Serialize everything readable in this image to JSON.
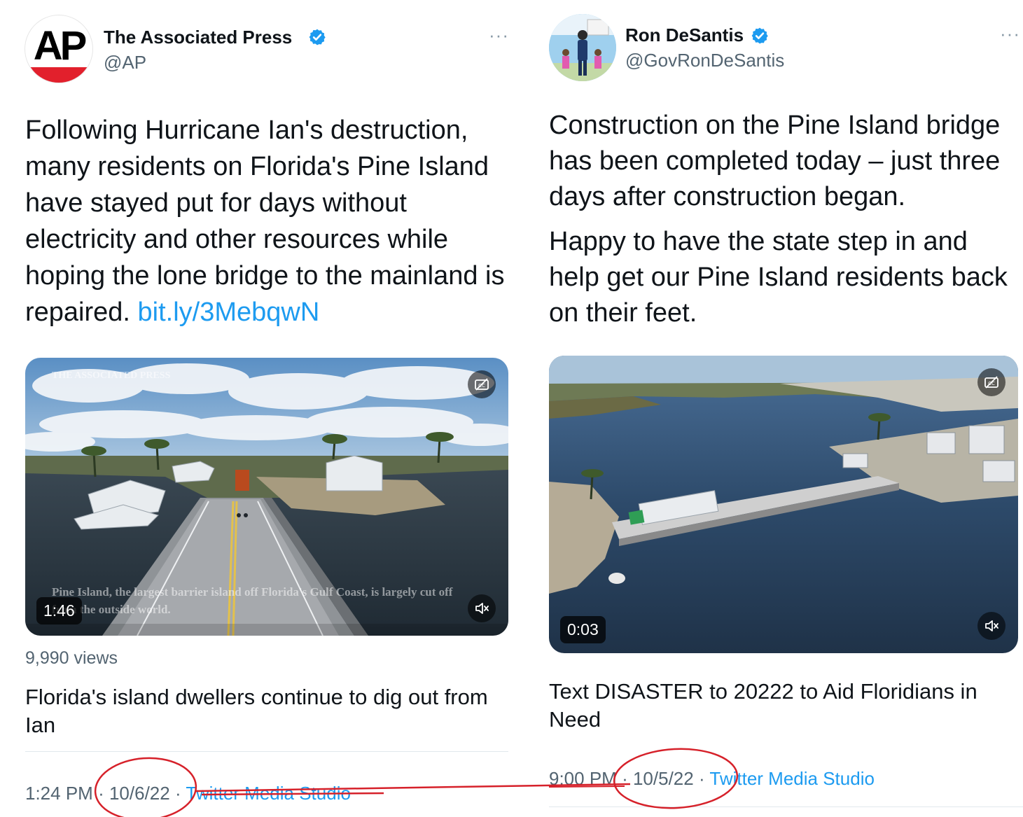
{
  "tweets": [
    {
      "author": {
        "name": "The Associated Press",
        "handle": "@AP",
        "logo_text": "AP"
      },
      "more": "···",
      "text": "Following Hurricane Ian's destruction, many residents on Florida's Pine Island have stayed put for days without electricity and other resources while hoping the lone bridge to the mainland is repaired.",
      "link": "bit.ly/3MebqwN",
      "video": {
        "duration": "1:46",
        "watermark": "THE ASSOCIATED PRESS",
        "caption_line1": "Pine Island, the largest barrier island off Florida's Gulf Coast, is largely cut off",
        "caption_line2": "from the outside world."
      },
      "views": "9,990 views",
      "card_title": "Florida's island dwellers continue to dig out from Ian",
      "time": "1:24 PM",
      "date": "10/6/22",
      "source": "Twitter Media Studio"
    },
    {
      "author": {
        "name": "Ron DeSantis",
        "handle": "@GovRonDeSantis"
      },
      "more": "···",
      "text_p1": "Construction on the Pine Island bridge has been completed today – just three days after construction began.",
      "text_p2": "Happy to have the state step in and help get our Pine Island residents back on their feet.",
      "video": {
        "duration": "0:03"
      },
      "card_title": "Text DISASTER to 20222 to Aid Floridians in Need",
      "time": "9:00 PM",
      "date": "10/5/22",
      "source": "Twitter Media Studio"
    }
  ],
  "separator": "·",
  "icons": [
    "verified-badge-icon",
    "more-options-icon",
    "captions-off-icon",
    "volume-muted-icon"
  ],
  "colors": {
    "link": "#1d9bf0",
    "verified": "#1d9bf0",
    "annotation": "#d6212a",
    "ap_red": "#e2202c"
  }
}
